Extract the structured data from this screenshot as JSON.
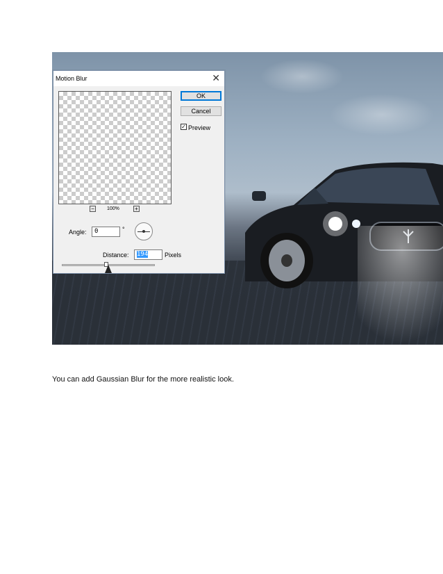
{
  "dialog": {
    "title": "Motion Blur",
    "close_symbol": "✕",
    "ok_label": "OK",
    "cancel_label": "Cancel",
    "preview_label": "Preview",
    "preview_checked": true,
    "zoom_out_symbol": "−",
    "zoom_in_symbol": "+",
    "zoom_value": "100%",
    "angle_label": "Angle:",
    "angle_value": "0",
    "angle_unit": "°",
    "distance_label": "Distance:",
    "distance_value": "194",
    "distance_unit": "Pixels",
    "slider_fraction": 0.48
  },
  "caption": "You can add Gaussian Blur for the more realistic look.",
  "colors": {
    "accent_blue": "#0078d7",
    "selection_blue": "#3399ff"
  }
}
